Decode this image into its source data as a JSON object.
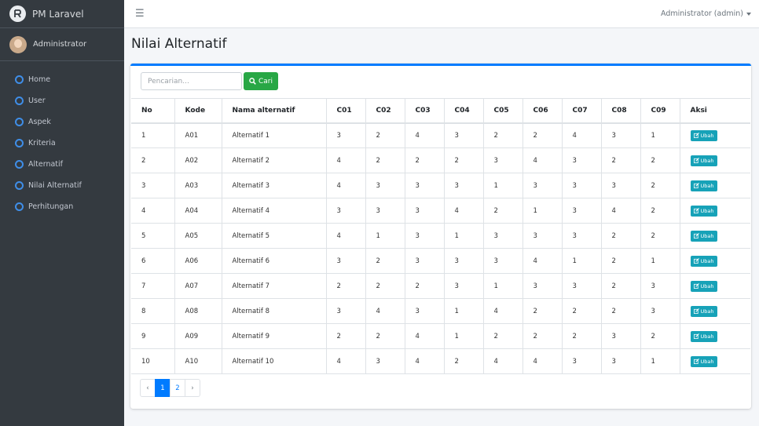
{
  "brand": {
    "title": "PM Laravel"
  },
  "user_panel": {
    "name": "Administrator"
  },
  "sidebar": {
    "items": [
      {
        "label": "Home"
      },
      {
        "label": "User"
      },
      {
        "label": "Aspek"
      },
      {
        "label": "Kriteria"
      },
      {
        "label": "Alternatif"
      },
      {
        "label": "Nilai Alternatif"
      },
      {
        "label": "Perhitungan"
      }
    ]
  },
  "navbar": {
    "user_menu": "Administrator (admin)"
  },
  "page": {
    "title": "Nilai Alternatif"
  },
  "search": {
    "placeholder": "Pencarian...",
    "button_label": "Cari"
  },
  "table": {
    "headers": [
      "No",
      "Kode",
      "Nama alternatif",
      "C01",
      "C02",
      "C03",
      "C04",
      "C05",
      "C06",
      "C07",
      "C08",
      "C09",
      "Aksi"
    ],
    "action_label": "Ubah",
    "rows": [
      [
        "1",
        "A01",
        "Alternatif 1",
        "3",
        "2",
        "4",
        "3",
        "2",
        "2",
        "4",
        "3",
        "1"
      ],
      [
        "2",
        "A02",
        "Alternatif 2",
        "4",
        "2",
        "2",
        "2",
        "3",
        "4",
        "3",
        "2",
        "2"
      ],
      [
        "3",
        "A03",
        "Alternatif 3",
        "4",
        "3",
        "3",
        "3",
        "1",
        "3",
        "3",
        "3",
        "2"
      ],
      [
        "4",
        "A04",
        "Alternatif 4",
        "3",
        "3",
        "3",
        "4",
        "2",
        "1",
        "3",
        "4",
        "2"
      ],
      [
        "5",
        "A05",
        "Alternatif 5",
        "4",
        "1",
        "3",
        "1",
        "3",
        "3",
        "3",
        "2",
        "2"
      ],
      [
        "6",
        "A06",
        "Alternatif 6",
        "3",
        "2",
        "3",
        "3",
        "3",
        "4",
        "1",
        "2",
        "1"
      ],
      [
        "7",
        "A07",
        "Alternatif 7",
        "2",
        "2",
        "2",
        "3",
        "1",
        "3",
        "3",
        "2",
        "3"
      ],
      [
        "8",
        "A08",
        "Alternatif 8",
        "3",
        "4",
        "3",
        "1",
        "4",
        "2",
        "2",
        "2",
        "3"
      ],
      [
        "9",
        "A09",
        "Alternatif 9",
        "2",
        "2",
        "4",
        "1",
        "2",
        "2",
        "2",
        "3",
        "2"
      ],
      [
        "10",
        "A10",
        "Alternatif 10",
        "4",
        "3",
        "4",
        "2",
        "4",
        "4",
        "3",
        "3",
        "1"
      ]
    ]
  },
  "pagination": {
    "prev": "‹",
    "pages": [
      "1",
      "2"
    ],
    "active_page": "1",
    "next": "›"
  },
  "colors": {
    "primary": "#007bff",
    "success": "#28a745",
    "info": "#17a2b8",
    "sidebar": "#343a40"
  }
}
